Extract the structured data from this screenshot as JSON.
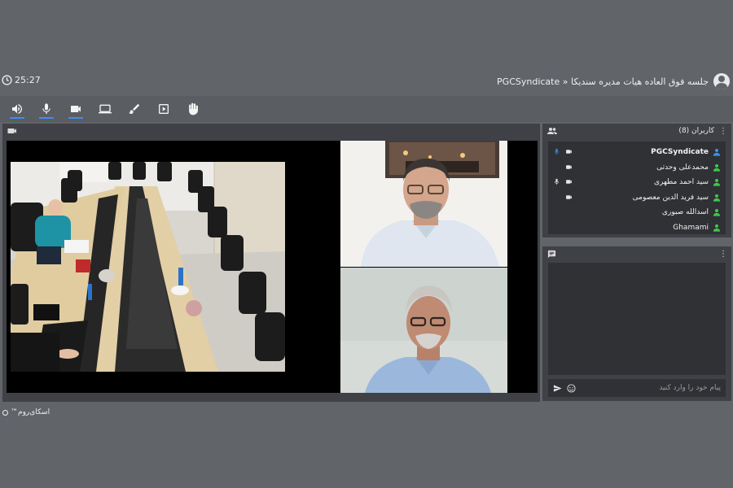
{
  "window": {
    "timer": "25:27",
    "breadcrumb": "PGCSyndicate » جلسه فوق العاده هیات مدیره سندیکا"
  },
  "toolbar": {
    "items": [
      {
        "name": "speaker-button",
        "icon": "speaker-icon",
        "active": true
      },
      {
        "name": "microphone-button",
        "icon": "microphone-icon",
        "active": true
      },
      {
        "name": "camera-button",
        "icon": "camera-icon",
        "active": true
      },
      {
        "name": "screen-share-button",
        "icon": "laptop-icon",
        "active": false
      },
      {
        "name": "whiteboard-button",
        "icon": "brush-icon",
        "active": false
      },
      {
        "name": "presentation-button",
        "icon": "play-box-icon",
        "active": false
      },
      {
        "name": "raise-hand-button",
        "icon": "hand-icon",
        "active": false
      }
    ]
  },
  "users_panel": {
    "title": "کاربران (8)",
    "users": [
      {
        "name": "PGCSyndicate",
        "mic": true,
        "cam": true,
        "role_color": "#3d8ef0",
        "bold": true
      },
      {
        "name": "محمدعلی وحدتی",
        "mic": false,
        "cam": true,
        "role_color": "#3cc94a",
        "bold": false
      },
      {
        "name": "سید احمد مطهری",
        "mic": true,
        "cam": true,
        "role_color": "#3cc94a",
        "bold": false
      },
      {
        "name": "سید فرید الدین معصومی",
        "mic": false,
        "cam": true,
        "role_color": "#3cc94a",
        "bold": false
      },
      {
        "name": "اسدالله صبوری",
        "mic": false,
        "cam": false,
        "role_color": "#3cc94a",
        "bold": false
      },
      {
        "name": "Ghamami",
        "mic": false,
        "cam": false,
        "role_color": "#3cc94a",
        "bold": false
      }
    ]
  },
  "chat_panel": {
    "placeholder": "پیام خود را وارد کنید"
  },
  "footer": {
    "brand": "اسکای‌روم™"
  },
  "colors": {
    "accent": "#3d8ef0",
    "online": "#3cc94a",
    "background": "#616469",
    "panel": "#3f4146"
  }
}
